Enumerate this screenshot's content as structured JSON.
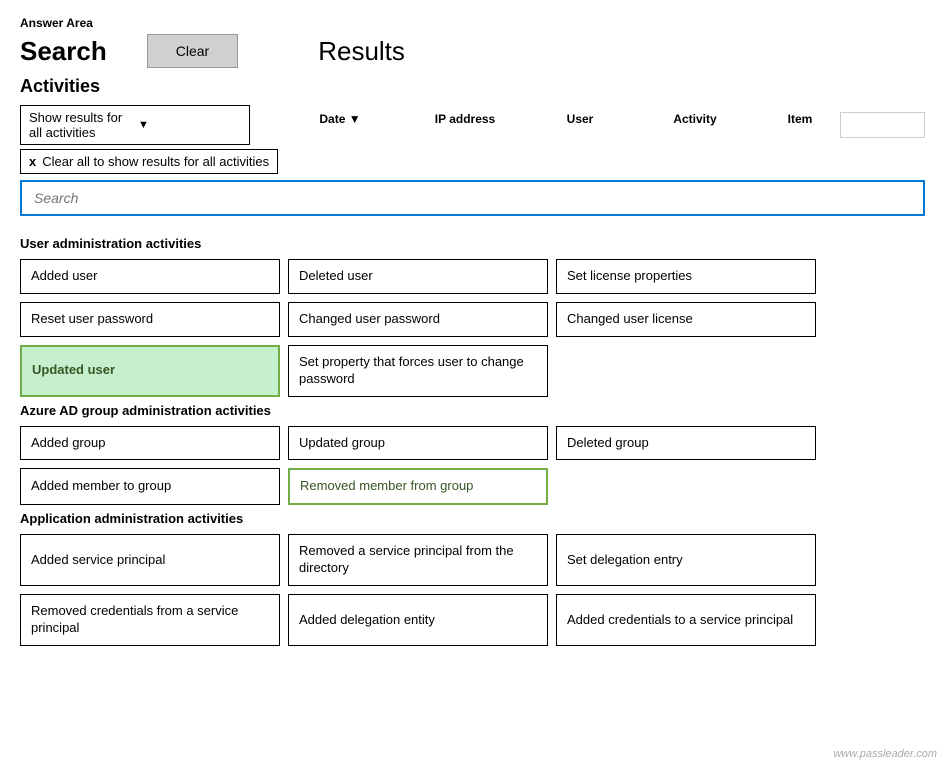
{
  "page": {
    "answer_area_label": "Answer Area",
    "search_title": "Search",
    "clear_button_label": "Clear",
    "results_title": "Results",
    "activities_label": "Activities",
    "columns": {
      "date": "Date",
      "date_arrow": "▼",
      "ip_address": "IP address",
      "user": "User",
      "activity": "Activity",
      "item": "Item"
    },
    "selector_label": "Show results for all activities",
    "filter_clear_label": "Clear all to show results for all activities",
    "search_placeholder": "Search",
    "sections": [
      {
        "name": "user_admin",
        "label": "User administration activities",
        "items": [
          {
            "id": "added-user",
            "label": "Added user",
            "selected": false,
            "green_fill": false
          },
          {
            "id": "deleted-user",
            "label": "Deleted user",
            "selected": false,
            "green_fill": false
          },
          {
            "id": "set-license-properties",
            "label": "Set license properties",
            "selected": false,
            "green_fill": false
          },
          {
            "id": "reset-user-password",
            "label": "Reset user password",
            "selected": false,
            "green_fill": false
          },
          {
            "id": "changed-user-password",
            "label": "Changed user password",
            "selected": false,
            "green_fill": false
          },
          {
            "id": "changed-user-license",
            "label": "Changed user license",
            "selected": false,
            "green_fill": false
          },
          {
            "id": "updated-user",
            "label": "Updated user",
            "selected": true,
            "green_fill": true
          },
          {
            "id": "set-property-change-password",
            "label": "Set property that forces user to change password",
            "selected": false,
            "green_fill": false
          },
          {
            "id": "empty1",
            "label": "",
            "selected": false,
            "green_fill": false,
            "empty": true
          }
        ]
      },
      {
        "name": "azure_ad_group",
        "label": "Azure AD group administration activities",
        "items": [
          {
            "id": "added-group",
            "label": "Added group",
            "selected": false,
            "green_fill": false
          },
          {
            "id": "updated-group",
            "label": "Updated group",
            "selected": false,
            "green_fill": false
          },
          {
            "id": "deleted-group",
            "label": "Deleted group",
            "selected": false,
            "green_fill": false
          },
          {
            "id": "added-member-to-group",
            "label": "Added member to group",
            "selected": false,
            "green_fill": false
          },
          {
            "id": "removed-member-from-group",
            "label": "Removed member from group",
            "selected": false,
            "green_fill": false,
            "outline_green": true
          },
          {
            "id": "empty2",
            "label": "",
            "selected": false,
            "green_fill": false,
            "empty": true
          }
        ]
      },
      {
        "name": "app_admin",
        "label": "Application administration activities",
        "items": [
          {
            "id": "added-service-principal",
            "label": "Added service principal",
            "selected": false,
            "green_fill": false
          },
          {
            "id": "removed-service-principal",
            "label": "Removed a service principal from the directory",
            "selected": false,
            "green_fill": false
          },
          {
            "id": "set-delegation-entry",
            "label": "Set delegation entry",
            "selected": false,
            "green_fill": false
          },
          {
            "id": "removed-credentials",
            "label": "Removed credentials from a service principal",
            "selected": false,
            "green_fill": false
          },
          {
            "id": "added-delegation-entity",
            "label": "Added delegation entity",
            "selected": false,
            "green_fill": false
          },
          {
            "id": "added-credentials-service-principal",
            "label": "Added credentials to a service principal",
            "selected": false,
            "green_fill": false
          }
        ]
      }
    ],
    "watermark": "www.passleader.com"
  }
}
